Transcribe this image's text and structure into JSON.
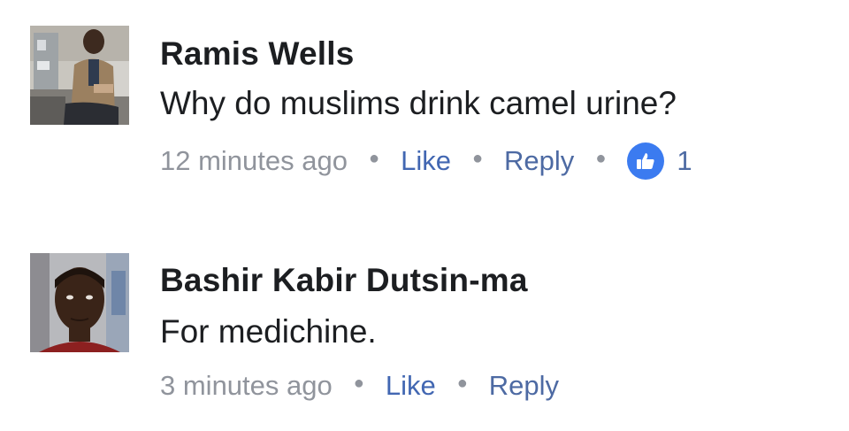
{
  "comments": [
    {
      "author": "Ramis Wells",
      "text": "Why do muslims drink camel urine?",
      "timestamp": "12 minutes ago",
      "like_label": "Like",
      "reply_label": "Reply",
      "like_count": "1"
    },
    {
      "author": "Bashir Kabir Dutsin-ma",
      "text": "For medichine.",
      "timestamp": "3 minutes ago",
      "like_label": "Like",
      "reply_label": "Reply"
    }
  ],
  "colors": {
    "link_blue": "#4267b2",
    "meta_gray": "#90949c",
    "like_badge": "#3b7bf0",
    "text_dark": "#1c1e21"
  },
  "icons": [
    "separator-dot-icon",
    "thumbs-up-icon"
  ]
}
